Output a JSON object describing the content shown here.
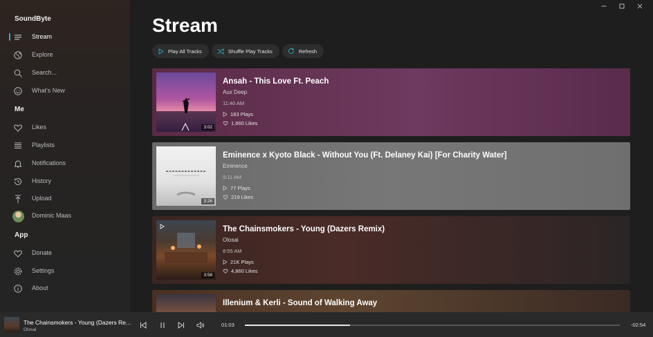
{
  "app": {
    "title": "SoundByte"
  },
  "sidebar": {
    "items": [
      {
        "label": "Stream",
        "icon": "stream-icon",
        "active": true
      },
      {
        "label": "Explore",
        "icon": "globe-icon"
      },
      {
        "label": "Search...",
        "icon": "search-icon"
      },
      {
        "label": "What's New",
        "icon": "smiley-icon"
      }
    ],
    "me_header": "Me",
    "me_items": [
      {
        "label": "Likes",
        "icon": "heart-icon"
      },
      {
        "label": "Playlists",
        "icon": "playlist-icon"
      },
      {
        "label": "Notifications",
        "icon": "bell-icon"
      },
      {
        "label": "History",
        "icon": "history-icon"
      },
      {
        "label": "Upload",
        "icon": "upload-icon"
      },
      {
        "label": "Dominic Maas",
        "icon": "avatar"
      }
    ],
    "app_header": "App",
    "app_items": [
      {
        "label": "Donate",
        "icon": "heart-icon"
      },
      {
        "label": "Settings",
        "icon": "gear-icon"
      },
      {
        "label": "About",
        "icon": "info-icon"
      }
    ]
  },
  "main": {
    "title": "Stream",
    "toolbar": {
      "play_all": "Play All Tracks",
      "shuffle": "Shuffle Play Tracks",
      "refresh": "Refresh"
    },
    "tracks": [
      {
        "title": "Ansah - This Love Ft. Peach",
        "artist": "Aux Deep",
        "time": "11:40 AM",
        "plays": "183 Plays",
        "likes": "1,660 Likes",
        "duration": "3:02"
      },
      {
        "title": "Eminence x Kyoto Black - Without You (Ft. Delaney Kai) [For Charity Water]",
        "artist": "Eminence",
        "time": "9:11 AM",
        "plays": "77 Plays",
        "likes": "219 Likes",
        "duration": "3:26"
      },
      {
        "title": "The Chainsmokers - Young (Dazers Remix)",
        "artist": "Olosai",
        "time": "8:55 AM",
        "plays": "21K Plays",
        "likes": "4,860 Likes",
        "duration": "3:58"
      },
      {
        "title": "Illenium & Kerli - Sound of Walking Away",
        "artist": "",
        "time": "",
        "plays": "",
        "likes": "",
        "duration": ""
      }
    ]
  },
  "player": {
    "title": "The Chainsmokers - Young (Dazers Re...",
    "artist": "Olosai",
    "current": "01:03",
    "remaining": "-02:54",
    "progress": 0.28
  },
  "colors": {
    "accent": "#26b5c4"
  }
}
